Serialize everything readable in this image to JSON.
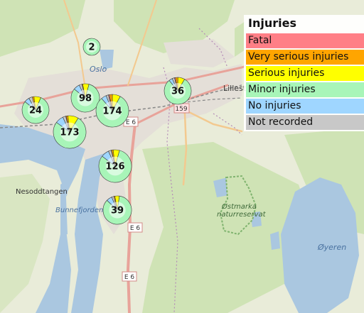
{
  "legend": {
    "title": "Injuries",
    "items": [
      {
        "label": "Fatal",
        "color": "#ff7f86"
      },
      {
        "label": "Very serious injuries",
        "color": "#ffa500"
      },
      {
        "label": "Serious injuries",
        "color": "#ffff00"
      },
      {
        "label": "Minor injuries",
        "color": "#a8f5b8"
      },
      {
        "label": "No injuries",
        "color": "#9fd6ff"
      },
      {
        "label": "Not recorded",
        "color": "#c8c8c8"
      }
    ]
  },
  "map_labels": {
    "oslo": "Oslo",
    "lillestrom": "Lillest",
    "nesoddtangen": "Nesoddtangen",
    "bunnefjorden": "Bunnefjorden",
    "ostmarka_1": "Østmarka",
    "ostmarka_2": "naturreservat",
    "oyeren": "Øyeren"
  },
  "road_shields": {
    "e6_a": "E 6",
    "e6_b": "E 6",
    "e6_c": "E 6",
    "r159": "159"
  },
  "clusters": [
    {
      "count": "2",
      "slices": {
        "fatal": 0,
        "very_serious": 0,
        "serious": 0,
        "minor": 2,
        "none": 0,
        "unknown": 0
      }
    },
    {
      "count": "24",
      "slices": {
        "fatal": 0,
        "very_serious": 0.5,
        "serious": 2,
        "minor": 19,
        "none": 1.5,
        "unknown": 1
      }
    },
    {
      "count": "98",
      "slices": {
        "fatal": 0,
        "very_serious": 1,
        "serious": 7,
        "minor": 80,
        "none": 7,
        "unknown": 3
      }
    },
    {
      "count": "174",
      "slices": {
        "fatal": 2,
        "very_serious": 5,
        "serious": 14,
        "minor": 140,
        "none": 9,
        "unknown": 4
      }
    },
    {
      "count": "36",
      "slices": {
        "fatal": 0.5,
        "very_serious": 1,
        "serious": 3,
        "minor": 29,
        "none": 1.5,
        "unknown": 1
      }
    },
    {
      "count": "173",
      "slices": {
        "fatal": 1,
        "very_serious": 3,
        "serious": 18,
        "minor": 132,
        "none": 14,
        "unknown": 5
      }
    },
    {
      "count": "126",
      "slices": {
        "fatal": 0.5,
        "very_serious": 2,
        "serious": 8,
        "minor": 102,
        "none": 10,
        "unknown": 3.5
      }
    },
    {
      "count": "39",
      "slices": {
        "fatal": 0,
        "very_serious": 0.5,
        "serious": 2,
        "minor": 33,
        "none": 2.5,
        "unknown": 1
      }
    }
  ]
}
